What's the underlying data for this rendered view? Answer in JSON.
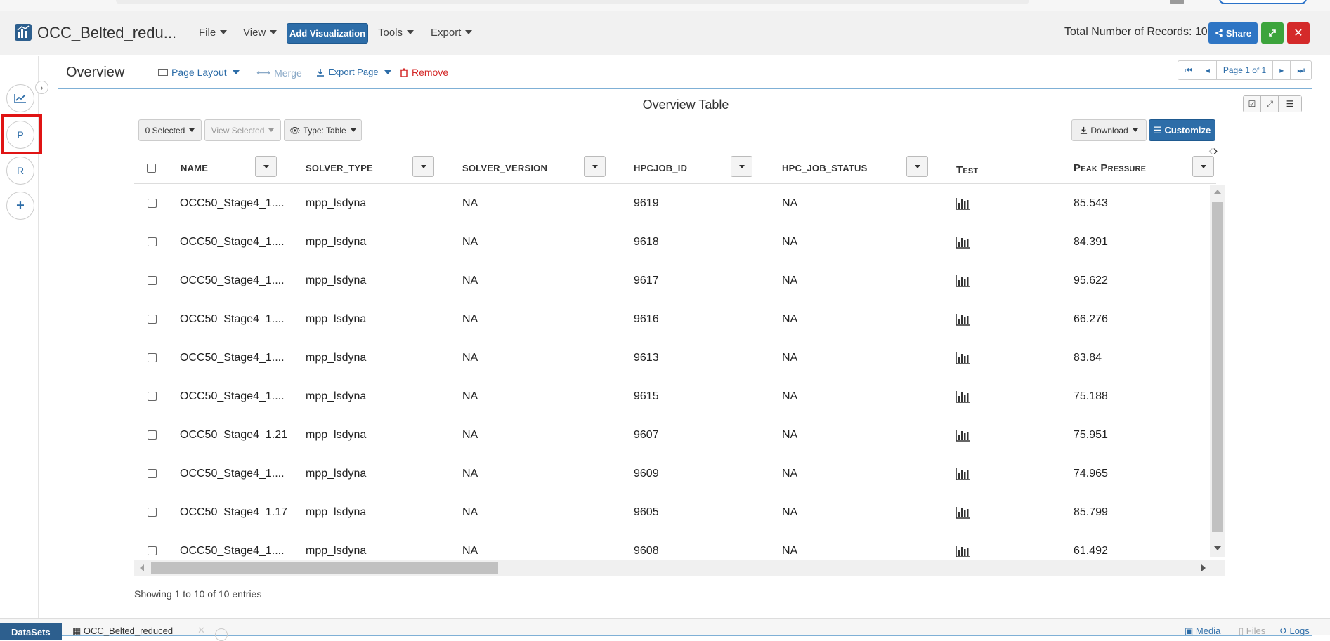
{
  "app": {
    "title": "OCC_Belted_redu...",
    "menus": [
      "File",
      "View",
      "Tools",
      "Export"
    ],
    "add_visualization": "Add Visualization",
    "records_label": "Total Number of Records: 10",
    "share_label": "Share"
  },
  "sidebar": {
    "buttons": [
      "P",
      "R"
    ]
  },
  "page": {
    "title": "Overview",
    "tools": {
      "page_layout": "Page Layout",
      "merge": "Merge",
      "export_page": "Export Page",
      "remove": "Remove"
    },
    "pager_label": "Page 1 of 1"
  },
  "table": {
    "title": "Overview Table",
    "selected_label": "0 Selected",
    "view_selected_label": "View Selected",
    "type_label": "Type: Table",
    "download_label": "Download",
    "customize_label": "Customize",
    "columns": [
      "NAME",
      "SOLVER_TYPE",
      "SOLVER_VERSION",
      "HPCJOB_ID",
      "HPC_JOB_STATUS",
      "Test",
      "Peak Pressure"
    ],
    "rows": [
      {
        "name": "OCC50_Stage4_1....",
        "solver_type": "mpp_lsdyna",
        "solver_version": "NA",
        "hpcjob_id": "9619",
        "status": "NA",
        "peak": "85.543"
      },
      {
        "name": "OCC50_Stage4_1....",
        "solver_type": "mpp_lsdyna",
        "solver_version": "NA",
        "hpcjob_id": "9618",
        "status": "NA",
        "peak": "84.391"
      },
      {
        "name": "OCC50_Stage4_1....",
        "solver_type": "mpp_lsdyna",
        "solver_version": "NA",
        "hpcjob_id": "9617",
        "status": "NA",
        "peak": "95.622"
      },
      {
        "name": "OCC50_Stage4_1....",
        "solver_type": "mpp_lsdyna",
        "solver_version": "NA",
        "hpcjob_id": "9616",
        "status": "NA",
        "peak": "66.276"
      },
      {
        "name": "OCC50_Stage4_1....",
        "solver_type": "mpp_lsdyna",
        "solver_version": "NA",
        "hpcjob_id": "9613",
        "status": "NA",
        "peak": "83.84"
      },
      {
        "name": "OCC50_Stage4_1....",
        "solver_type": "mpp_lsdyna",
        "solver_version": "NA",
        "hpcjob_id": "9615",
        "status": "NA",
        "peak": "75.188"
      },
      {
        "name": "OCC50_Stage4_1.21",
        "solver_type": "mpp_lsdyna",
        "solver_version": "NA",
        "hpcjob_id": "9607",
        "status": "NA",
        "peak": "75.951"
      },
      {
        "name": "OCC50_Stage4_1....",
        "solver_type": "mpp_lsdyna",
        "solver_version": "NA",
        "hpcjob_id": "9609",
        "status": "NA",
        "peak": "74.965"
      },
      {
        "name": "OCC50_Stage4_1.17",
        "solver_type": "mpp_lsdyna",
        "solver_version": "NA",
        "hpcjob_id": "9605",
        "status": "NA",
        "peak": "85.799"
      },
      {
        "name": "OCC50_Stage4_1....",
        "solver_type": "mpp_lsdyna",
        "solver_version": "NA",
        "hpcjob_id": "9608",
        "status": "NA",
        "peak": "61.492"
      }
    ],
    "showing_label": "Showing 1 to 10 of 10 entries"
  },
  "footer": {
    "datasets_label": "DataSets",
    "tab_label": "OCC_Belted_reduced",
    "media_label": "Media",
    "files_label": "Files",
    "logs_label": "Logs"
  },
  "colors": {
    "primary": "#2d6da8",
    "success": "#3ca43c",
    "danger": "#d42a2a",
    "highlight": "#e01414"
  }
}
